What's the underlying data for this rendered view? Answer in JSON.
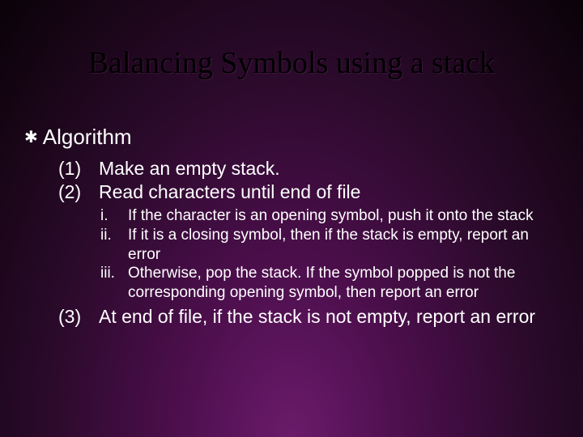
{
  "slide": {
    "title": "Balancing Symbols using a stack",
    "section_header": "Algorithm",
    "steps": [
      {
        "num": "(1)",
        "text": "Make an empty stack."
      },
      {
        "num": "(2)",
        "text": "Read characters until end of file"
      },
      {
        "num": "(3)",
        "text": "At end of file, if the stack is not empty, report an error"
      }
    ],
    "substeps": [
      {
        "roman": "i.",
        "text": "If the character is an opening symbol, push it onto the stack"
      },
      {
        "roman": "ii.",
        "text": "If it is a closing symbol, then if the stack is empty, report an error"
      },
      {
        "roman": "iii.",
        "text": "Otherwise, pop the stack. If the symbol popped is not the corresponding opening symbol, then report an error"
      }
    ]
  }
}
